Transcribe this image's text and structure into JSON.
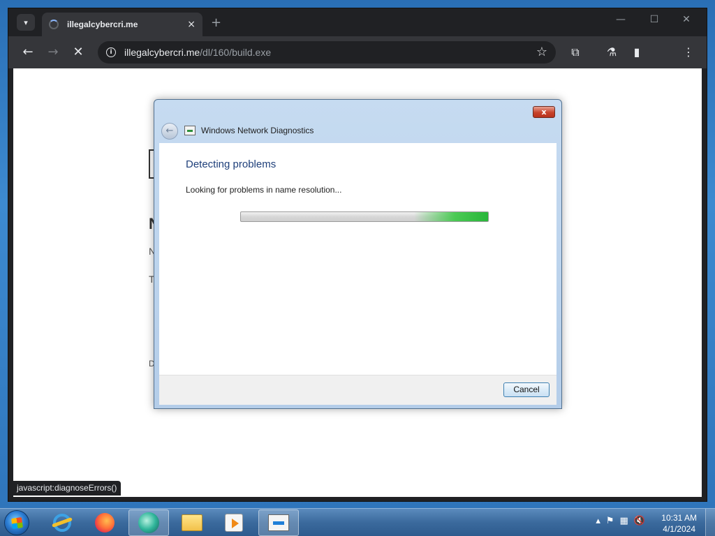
{
  "browser": {
    "tab_title": "illegalcybercri.me",
    "tab_close": "×",
    "new_tab": "+",
    "url_host": "illegalcybercri.me",
    "url_path": "/dl/160/build.exe",
    "status_link": "javascript:diagnoseErrors()"
  },
  "page_fragments": [
    "N",
    "N",
    "T",
    "D"
  ],
  "dialog": {
    "title": "Windows Network Diagnostics",
    "close_label": "x",
    "heading": "Detecting problems",
    "status": "Looking for problems in name resolution...",
    "cancel_label": "Cancel"
  },
  "taskbar": {
    "apps": [
      "internet-explorer-icon",
      "firefox-icon",
      "green-app-icon",
      "file-explorer-icon",
      "media-player-icon",
      "network-diagnostics-icon"
    ],
    "clock_time": "10:31 AM",
    "clock_date": "4/1/2024"
  }
}
